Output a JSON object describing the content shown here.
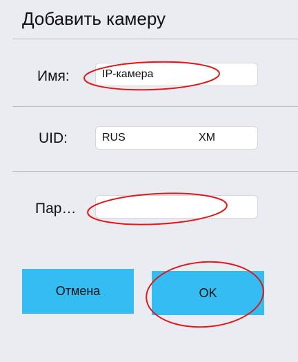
{
  "dialog": {
    "title": "Добавить камеру"
  },
  "fields": {
    "name": {
      "label": "Имя:",
      "value": "IP-камера"
    },
    "uid": {
      "label": "UID:",
      "value_part1": "RUS",
      "value_part2": "XM"
    },
    "password": {
      "label": "Пар…",
      "value": ""
    }
  },
  "buttons": {
    "cancel_label": "Отмена",
    "ok_label": "OK"
  },
  "colors": {
    "background": "#ebebf2",
    "button_accent": "#33bdf3",
    "annotation_red": "#e01818"
  }
}
